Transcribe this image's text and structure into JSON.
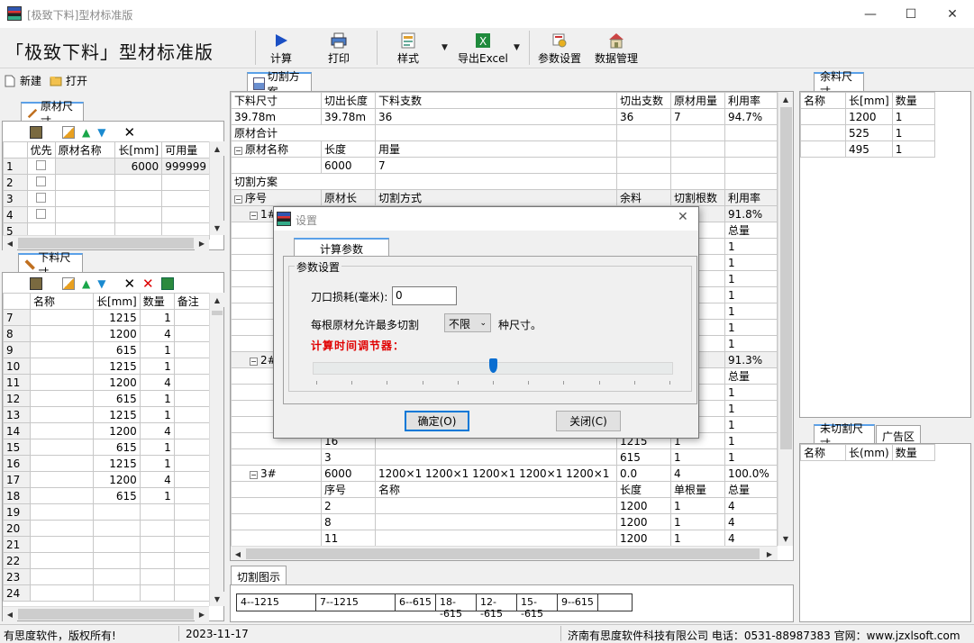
{
  "window": {
    "title": "[极致下料]型材标准版",
    "minimize": "—",
    "maximize": "☐",
    "close": "✕"
  },
  "brand": "「极致下料」型材标准版",
  "toolbar": {
    "calc": "计算",
    "print": "打印",
    "style": "样式",
    "export": "导出Excel",
    "params": "参数设置",
    "data": "数据管理"
  },
  "file": {
    "new": "新建",
    "open": "打开"
  },
  "raw": {
    "tab": "原材尺寸",
    "headers": [
      "优先",
      "原材名称",
      "长[mm]",
      "可用量"
    ],
    "rows": [
      {
        "n": "1",
        "len": "6000",
        "qty": "999999"
      },
      {
        "n": "2",
        "len": "",
        "qty": ""
      },
      {
        "n": "3",
        "len": "",
        "qty": ""
      },
      {
        "n": "4",
        "len": "",
        "qty": ""
      },
      {
        "n": "5",
        "len": "",
        "qty": ""
      }
    ]
  },
  "cut": {
    "tab": "下料尺寸",
    "headers": [
      "名称",
      "长[mm]",
      "数量",
      "备注"
    ],
    "rows": [
      {
        "n": "7",
        "len": "1215",
        "qty": "1"
      },
      {
        "n": "8",
        "len": "1200",
        "qty": "4"
      },
      {
        "n": "9",
        "len": "615",
        "qty": "1"
      },
      {
        "n": "10",
        "len": "1215",
        "qty": "1"
      },
      {
        "n": "11",
        "len": "1200",
        "qty": "4"
      },
      {
        "n": "12",
        "len": "615",
        "qty": "1"
      },
      {
        "n": "13",
        "len": "1215",
        "qty": "1"
      },
      {
        "n": "14",
        "len": "1200",
        "qty": "4"
      },
      {
        "n": "15",
        "len": "615",
        "qty": "1"
      },
      {
        "n": "16",
        "len": "1215",
        "qty": "1"
      },
      {
        "n": "17",
        "len": "1200",
        "qty": "4"
      },
      {
        "n": "18",
        "len": "615",
        "qty": "1"
      },
      {
        "n": "19",
        "len": "",
        "qty": ""
      },
      {
        "n": "20",
        "len": "",
        "qty": ""
      },
      {
        "n": "21",
        "len": "",
        "qty": ""
      },
      {
        "n": "22",
        "len": "",
        "qty": ""
      },
      {
        "n": "23",
        "len": "",
        "qty": ""
      },
      {
        "n": "24",
        "len": "",
        "qty": ""
      }
    ]
  },
  "plan": {
    "tab": "切割方案",
    "sum_headers": [
      "下料尺寸",
      "切出长度",
      "下料支数",
      "切出支数",
      "原材用量",
      "利用率"
    ],
    "sum_values": [
      "39.78m",
      "39.78m",
      "36",
      "36",
      "7",
      "94.7%"
    ],
    "raw_total": "原材合计",
    "raw_headers": [
      "原材名称",
      "长度",
      "用量"
    ],
    "raw_values": [
      "6000",
      "7"
    ],
    "plan_label": "切割方案",
    "plan_headers": [
      "序号",
      "原材长",
      "切割方式",
      "余料",
      "切割根数",
      "利用率"
    ],
    "g1": {
      "id": "1#",
      "rate": "91.8%",
      "total_h": "总量",
      "ones": [
        "1",
        "1",
        "1",
        "1",
        "1",
        "1",
        "1"
      ]
    },
    "g2": {
      "id": "2#",
      "rate": "91.3%",
      "total_h": "总量",
      "ones": [
        "1",
        "1",
        "1"
      ]
    },
    "g2_tail": [
      {
        "a": "16",
        "c": "1215",
        "d": "1",
        "e": "1"
      },
      {
        "a": "3",
        "c": "615",
        "d": "1",
        "e": "1"
      }
    ],
    "g3": {
      "id": "3#",
      "len": "6000",
      "method": "1200×1 1200×1 1200×1 1200×1 1200×1",
      "rem": "0.0",
      "count": "4",
      "rate": "100.0%"
    },
    "g3_headers": [
      "序号",
      "名称",
      "长度",
      "单根量",
      "总量"
    ],
    "g3_rows": [
      {
        "a": "2",
        "c": "1200",
        "d": "1",
        "e": "4"
      },
      {
        "a": "8",
        "c": "1200",
        "d": "1",
        "e": "4"
      },
      {
        "a": "11",
        "c": "1200",
        "d": "1",
        "e": "4"
      }
    ]
  },
  "diagram": {
    "tab": "切割图示",
    "labels": [
      "4--1215",
      "7--1215",
      "6--615",
      "18--615",
      "12--615",
      "15--615",
      "9--615"
    ]
  },
  "leftover": {
    "tab": "余料尺寸",
    "headers": [
      "名称",
      "长[mm]",
      "数量"
    ],
    "rows": [
      {
        "len": "1200",
        "qty": "1"
      },
      {
        "len": "525",
        "qty": "1"
      },
      {
        "len": "495",
        "qty": "1"
      }
    ]
  },
  "uncut": {
    "tab": "未切割尺寸",
    "ad_tab": "广告区",
    "headers": [
      "名称",
      "长(mm)",
      "数量"
    ]
  },
  "dialog": {
    "title": "设置",
    "tab": "计算参数",
    "group": "参数设置",
    "kerf_label": "刀口损耗(毫米):",
    "kerf_value": "0",
    "max_label": "每根原材允许最多切割",
    "max_value": "不限",
    "max_suffix": "种尺寸。",
    "slider_label": "计算时间调节器：",
    "slider_value": 0.5,
    "ok": "确定(O)",
    "close": "关闭(C)"
  },
  "status": {
    "left": "有思度软件，版权所有!",
    "date": "2023-11-17",
    "right": "济南有思度软件科技有限公司 电话：0531-88987383 官网：www.jzxlsoft.com"
  }
}
